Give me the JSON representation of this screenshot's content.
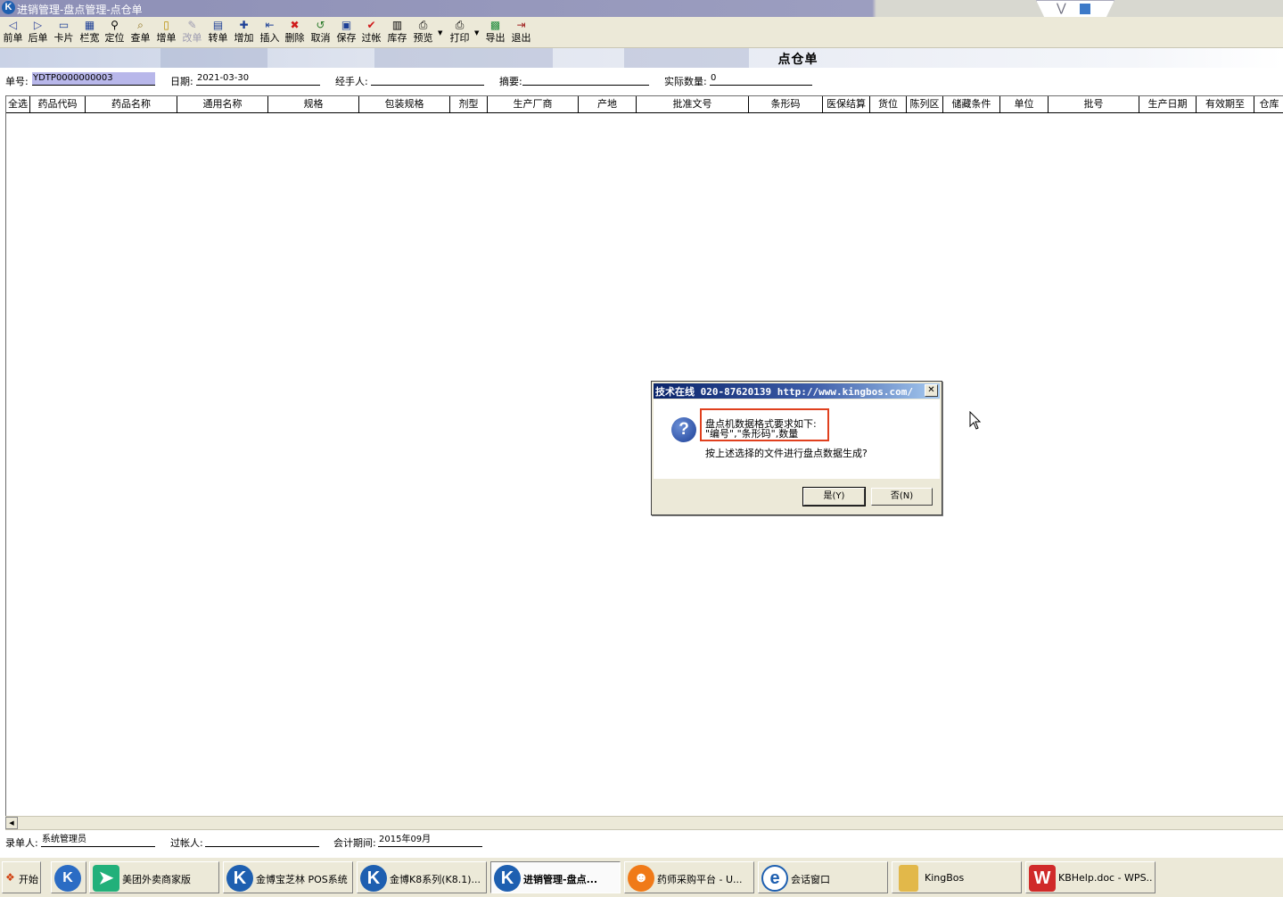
{
  "window": {
    "title": "进销管理-盘点管理-点仓单",
    "app_icon_letter": "K"
  },
  "toolbar": {
    "buttons": [
      {
        "label": "前单",
        "icon": "prev-icon",
        "glyph": "◁"
      },
      {
        "label": "后单",
        "icon": "next-icon",
        "glyph": "▷"
      },
      {
        "label": "卡片",
        "icon": "card-icon",
        "glyph": "▭"
      },
      {
        "label": "栏宽",
        "icon": "column-width-icon",
        "glyph": "▦"
      },
      {
        "label": "定位",
        "icon": "binoculars-icon",
        "glyph": "⚲"
      },
      {
        "label": "查单",
        "icon": "search-doc-icon",
        "glyph": "⌕"
      },
      {
        "label": "增单",
        "icon": "new-doc-icon",
        "glyph": "▯"
      },
      {
        "label": "改单",
        "icon": "edit-doc-icon",
        "glyph": "✎",
        "disabled": true
      },
      {
        "label": "转单",
        "icon": "transfer-icon",
        "glyph": "▤"
      },
      {
        "label": "增加",
        "icon": "add-icon",
        "glyph": "✚"
      },
      {
        "label": "插入",
        "icon": "insert-icon",
        "glyph": "⇤"
      },
      {
        "label": "删除",
        "icon": "delete-icon",
        "glyph": "✖"
      },
      {
        "label": "取消",
        "icon": "undo-icon",
        "glyph": "↺"
      },
      {
        "label": "保存",
        "icon": "save-icon",
        "glyph": "▣"
      },
      {
        "label": "过帐",
        "icon": "check-icon",
        "glyph": "✔"
      },
      {
        "label": "库存",
        "icon": "stock-icon",
        "glyph": "▥"
      },
      {
        "label": "预览",
        "icon": "preview-icon",
        "glyph": "⎙"
      },
      {
        "label": "打印",
        "icon": "print-icon",
        "glyph": "⎙"
      },
      {
        "label": "导出",
        "icon": "excel-icon",
        "glyph": "▩"
      },
      {
        "label": "退出",
        "icon": "exit-icon",
        "glyph": "⇥"
      }
    ]
  },
  "banner": {
    "title": "点仓单"
  },
  "form": {
    "doc_no_label": "单号:",
    "doc_no": "YDTP0000000003",
    "date_label": "日期:",
    "date": "2021-03-30",
    "handler_label": "经手人:",
    "handler": "",
    "summary_label": "摘要:",
    "summary": "",
    "actual_qty_label": "实际数量:",
    "actual_qty": "0"
  },
  "grid": {
    "columns": [
      "全选",
      "药品代码",
      "药品名称",
      "通用名称",
      "规格",
      "包装规格",
      "剂型",
      "生产厂商",
      "产地",
      "批准文号",
      "条形码",
      "医保结算",
      "货位",
      "陈列区",
      "储藏条件",
      "单位",
      "批号",
      "生产日期",
      "有效期至",
      "仓库"
    ]
  },
  "footer": {
    "entry_label": "录单人:",
    "entry_user": "系统管理员",
    "post_label": "过帐人:",
    "post_user": "",
    "period_label": "会计期间:",
    "period": "2015年09月"
  },
  "dialog": {
    "title": "技术在线 020-87620139 http://www.kingbos.com/",
    "line1": "盘点机数据格式要求如下:",
    "line2": "\"编号\",\"条形码\",数量",
    "line3": "按上述选择的文件进行盘点数据生成?",
    "yes_label": "是(Y)",
    "no_label": "否(N)",
    "icon": "question-icon",
    "highlight_color": "#e0401e"
  },
  "taskbar": {
    "start_label": "开始",
    "items": [
      {
        "label": "",
        "icon": "kingbos-icon"
      },
      {
        "label": "美团外卖商家版",
        "icon": "meituan-icon"
      },
      {
        "label": "金博宝芝林 POS系统",
        "icon": "kingbos-icon"
      },
      {
        "label": "金博K8系列(K8.1)...",
        "icon": "kingbos-icon"
      },
      {
        "label": "进销管理-盘点...",
        "icon": "kingbos-icon",
        "active": true
      },
      {
        "label": "药师采购平台 - U...",
        "icon": "uc-browser-icon"
      },
      {
        "label": "会话窗口",
        "icon": "chat-icon"
      },
      {
        "label": "KingBos",
        "icon": "folder-icon"
      },
      {
        "label": "KBHelp.doc - WPS...",
        "icon": "wps-icon"
      }
    ]
  }
}
